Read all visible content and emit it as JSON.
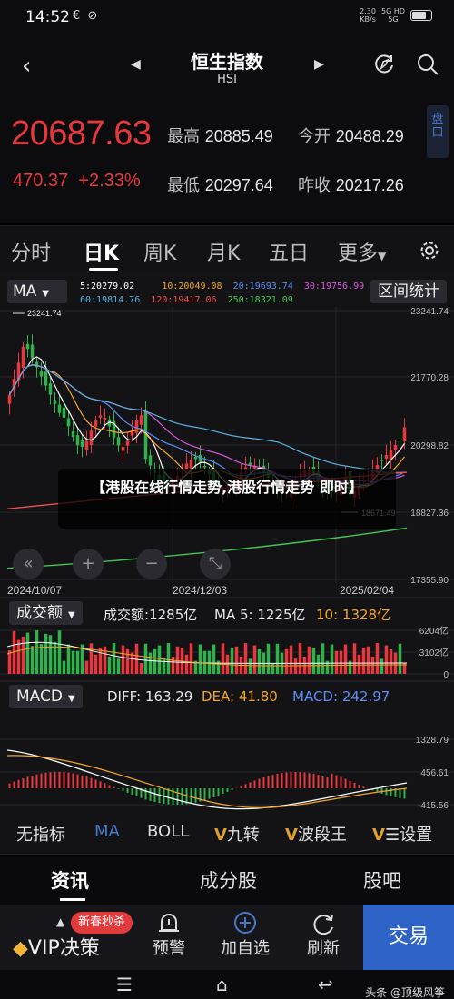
{
  "status": {
    "time": "14:52",
    "left_icons": "€ ⊘",
    "speed_value": "2.30",
    "speed_unit": "KB/s",
    "net_top": "5G HD",
    "net_bottom": "5G"
  },
  "header": {
    "title": "恒生指数",
    "subtitle": "HSI"
  },
  "quote": {
    "price": "20687.63",
    "change": "470.37",
    "change_pct": "+2.33%",
    "high_label": "最高",
    "high": "20885.49",
    "open_label": "今开",
    "open": "20488.29",
    "low_label": "最低",
    "low": "20297.64",
    "prev_close_label": "昨收",
    "prev_close": "20217.26",
    "side_tab": "盘口"
  },
  "period_tabs": [
    "分时",
    "日K",
    "周K",
    "月K",
    "五日",
    "更多"
  ],
  "ma_panel": {
    "select": "MA",
    "values": [
      {
        "label": "5:20279.02",
        "color": "#ffffff"
      },
      {
        "label": "10:20049.08",
        "color": "#f4a52c"
      },
      {
        "label": "20:19693.74",
        "color": "#5c8ef5"
      },
      {
        "label": "30:19756.99",
        "color": "#d85ad8"
      },
      {
        "label": "60:19814.76",
        "color": "#5ab0e0"
      },
      {
        "label": "120:19417.06",
        "color": "#ee5050"
      },
      {
        "label": "250:18321.09",
        "color": "#45c455"
      }
    ],
    "range_button": "区间统计"
  },
  "price_axis": [
    "23241.74",
    "21770.28",
    "20298.82",
    "18827.36",
    "17355.90"
  ],
  "annotations": {
    "max_label": "23241.74",
    "min_label": "18671.49"
  },
  "date_axis": [
    "2024/10/07",
    "2024/12/03",
    "2025/02/04"
  ],
  "chart_controls": [
    "«",
    "+",
    "−",
    "⤡"
  ],
  "toast": "【港股在线行情走势,港股行情走势 即时】",
  "volume_panel": {
    "select": "成交额",
    "label": "成交额:",
    "value": "1285亿",
    "ma5_label": "MA 5:",
    "ma5": "1225亿",
    "ma10_label": "10:",
    "ma10": "1328亿",
    "axis": [
      "6204亿",
      "3102亿",
      "0"
    ]
  },
  "macd_panel": {
    "select": "MACD",
    "diff_label": "DIFF:",
    "diff": "163.29",
    "dea_label": "DEA:",
    "dea": "41.80",
    "macd_label": "MACD:",
    "macd": "242.97",
    "axis": [
      "1328.79",
      "456.61",
      "-415.56"
    ]
  },
  "indicator_row": [
    "无指标",
    "MA",
    "BOLL",
    "九转",
    "波段王",
    "设置"
  ],
  "info_tabs": [
    "资讯",
    "成分股",
    "股吧"
  ],
  "bottom_bar": {
    "promo": "新春秒杀",
    "vip": "VIP决策",
    "items": [
      "预警",
      "加自选",
      "刷新"
    ],
    "trade": "交易"
  },
  "watermark": "头条 @顶级风筝",
  "colors": {
    "up": "#e8383d",
    "down": "#2fb24a",
    "accent": "#2e63c8"
  }
}
